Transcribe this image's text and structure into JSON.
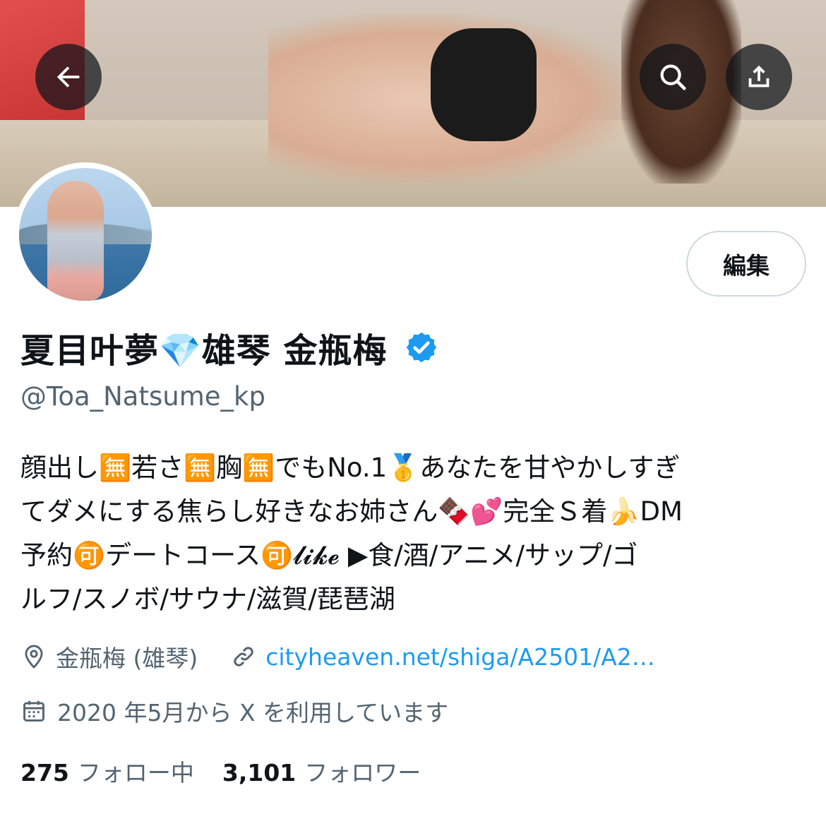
{
  "header": {
    "back_icon": "arrow-left-icon",
    "search_icon": "search-icon",
    "share_icon": "share-icon"
  },
  "profile": {
    "edit_label": "編集",
    "display_name": "夏目叶夢💎雄琴 金瓶梅",
    "verified": true,
    "handle": "@Toa_Natsume_kp",
    "bio_lines": [
      "顔出し🈚若さ🈚胸🈚でもNo.1🥇あなたを甘やかしすぎ",
      "てダメにする焦らし好きなお姉さん🍫💕完全Ｓ着🍌DM",
      "予約🉑デートコース🉑𝓵𝓲𝓴𝓮 ▶︎食/酒/アニメ/サップ/ゴ",
      "ルフ/スノボ/サウナ/滋賀/琵琶湖"
    ],
    "location": "金瓶梅 (雄琴)",
    "website": "cityheaven.net/shiga/A2501/A2…",
    "joined": "2020 年5月から X を利用しています",
    "following_count": "275",
    "following_label": "フォロー中",
    "followers_count": "3,101",
    "followers_label": "フォロワー"
  },
  "colors": {
    "accent": "#1d9bf0",
    "secondary_text": "#536471",
    "primary_text": "#0f1419",
    "verified_badge": "#1d9bf0"
  }
}
